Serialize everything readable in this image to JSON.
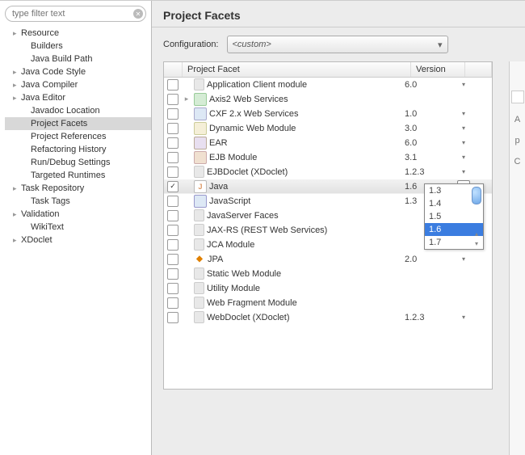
{
  "filter": {
    "placeholder": "type filter text"
  },
  "tree": [
    {
      "label": "Resource",
      "indent": 1,
      "expand": "▸"
    },
    {
      "label": "Builders",
      "indent": 2,
      "expand": ""
    },
    {
      "label": "Java Build Path",
      "indent": 2,
      "expand": ""
    },
    {
      "label": "Java Code Style",
      "indent": 1,
      "expand": "▸"
    },
    {
      "label": "Java Compiler",
      "indent": 1,
      "expand": "▸"
    },
    {
      "label": "Java Editor",
      "indent": 1,
      "expand": "▸"
    },
    {
      "label": "Javadoc Location",
      "indent": 2,
      "expand": ""
    },
    {
      "label": "Project Facets",
      "indent": 2,
      "expand": "",
      "selected": true
    },
    {
      "label": "Project References",
      "indent": 2,
      "expand": ""
    },
    {
      "label": "Refactoring History",
      "indent": 2,
      "expand": ""
    },
    {
      "label": "Run/Debug Settings",
      "indent": 2,
      "expand": ""
    },
    {
      "label": "Targeted Runtimes",
      "indent": 2,
      "expand": ""
    },
    {
      "label": "Task Repository",
      "indent": 1,
      "expand": "▸"
    },
    {
      "label": "Task Tags",
      "indent": 2,
      "expand": ""
    },
    {
      "label": "Validation",
      "indent": 1,
      "expand": "▸"
    },
    {
      "label": "WikiText",
      "indent": 2,
      "expand": ""
    },
    {
      "label": "XDoclet",
      "indent": 1,
      "expand": "▸"
    }
  ],
  "title": "Project Facets",
  "config": {
    "label": "Configuration:",
    "value": "<custom>"
  },
  "columns": {
    "facet": "Project Facet",
    "version": "Version"
  },
  "facets": [
    {
      "name": "Application Client module",
      "version": "6.0",
      "checked": false,
      "icon": "doc",
      "twisty": "",
      "dd": "arrow"
    },
    {
      "name": "Axis2 Web Services",
      "version": "",
      "checked": false,
      "icon": "axis",
      "twisty": "▸",
      "dd": ""
    },
    {
      "name": "CXF 2.x Web Services",
      "version": "1.0",
      "checked": false,
      "icon": "cxf",
      "twisty": "",
      "dd": "arrow"
    },
    {
      "name": "Dynamic Web Module",
      "version": "3.0",
      "checked": false,
      "icon": "dyn",
      "twisty": "",
      "dd": "arrow"
    },
    {
      "name": "EAR",
      "version": "6.0",
      "checked": false,
      "icon": "ear",
      "twisty": "",
      "dd": "arrow"
    },
    {
      "name": "EJB Module",
      "version": "3.1",
      "checked": false,
      "icon": "ejb",
      "twisty": "",
      "dd": "arrow"
    },
    {
      "name": "EJBDoclet (XDoclet)",
      "version": "1.2.3",
      "checked": false,
      "icon": "doc",
      "twisty": "",
      "dd": "arrow"
    },
    {
      "name": "Java",
      "version": "1.6",
      "checked": true,
      "icon": "java",
      "twisty": "",
      "dd": "open",
      "selected": true
    },
    {
      "name": "JavaScript",
      "version": "1.3",
      "checked": false,
      "icon": "js",
      "twisty": "",
      "dd": ""
    },
    {
      "name": "JavaServer Faces",
      "version": "",
      "checked": false,
      "icon": "doc",
      "twisty": "",
      "dd": ""
    },
    {
      "name": "JAX-RS (REST Web Services)",
      "version": "",
      "checked": false,
      "icon": "doc",
      "twisty": "",
      "dd": ""
    },
    {
      "name": "JCA Module",
      "version": "",
      "checked": false,
      "icon": "doc",
      "twisty": "",
      "dd": ""
    },
    {
      "name": "JPA",
      "version": "2.0",
      "checked": false,
      "icon": "jpa",
      "twisty": "",
      "dd": "arrow"
    },
    {
      "name": "Static Web Module",
      "version": "",
      "checked": false,
      "icon": "doc",
      "twisty": "",
      "dd": ""
    },
    {
      "name": "Utility Module",
      "version": "",
      "checked": false,
      "icon": "doc",
      "twisty": "",
      "dd": ""
    },
    {
      "name": "Web Fragment Module",
      "version": "",
      "checked": false,
      "icon": "doc",
      "twisty": "",
      "dd": ""
    },
    {
      "name": "WebDoclet (XDoclet)",
      "version": "1.2.3",
      "checked": false,
      "icon": "doc",
      "twisty": "",
      "dd": "arrow"
    }
  ],
  "dropdown": {
    "options": [
      "1.3",
      "1.4",
      "1.5",
      "1.6",
      "1.7"
    ],
    "highlight": "1.6"
  },
  "rpane": [
    "A",
    "p",
    "C"
  ]
}
